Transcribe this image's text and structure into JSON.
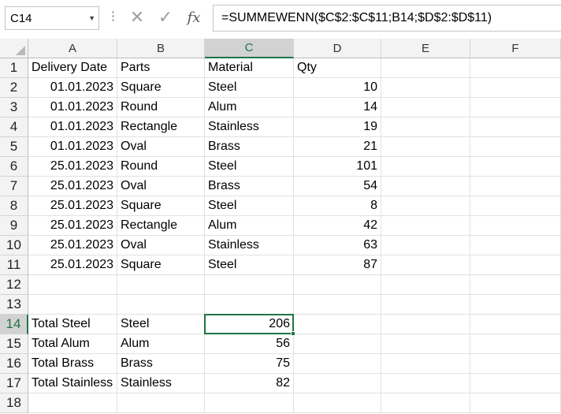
{
  "name_box": {
    "value": "C14"
  },
  "formula_bar": {
    "formula": "=SUMMEWENN($C$2:$C$11;B14;$D$2:$D$11)",
    "cancel_glyph": "✕",
    "enter_glyph": "✓",
    "fx_label": "fx"
  },
  "columns": [
    "A",
    "B",
    "C",
    "D",
    "E",
    "F"
  ],
  "active_column": "C",
  "active_row": 14,
  "rows": [
    {
      "n": "1",
      "a": "Delivery Date",
      "b": "Parts",
      "c": "Material",
      "d": "Qty"
    },
    {
      "n": "2",
      "a": "01.01.2023",
      "b": "Square",
      "c": "Steel",
      "d": "10"
    },
    {
      "n": "3",
      "a": "01.01.2023",
      "b": "Round",
      "c": "Alum",
      "d": "14"
    },
    {
      "n": "4",
      "a": "01.01.2023",
      "b": "Rectangle",
      "c": "Stainless",
      "d": "19"
    },
    {
      "n": "5",
      "a": "01.01.2023",
      "b": "Oval",
      "c": "Brass",
      "d": "21"
    },
    {
      "n": "6",
      "a": "25.01.2023",
      "b": "Round",
      "c": "Steel",
      "d": "101"
    },
    {
      "n": "7",
      "a": "25.01.2023",
      "b": "Oval",
      "c": "Brass",
      "d": "54"
    },
    {
      "n": "8",
      "a": "25.01.2023",
      "b": "Square",
      "c": "Steel",
      "d": "8"
    },
    {
      "n": "9",
      "a": "25.01.2023",
      "b": "Rectangle",
      "c": "Alum",
      "d": "42"
    },
    {
      "n": "10",
      "a": "25.01.2023",
      "b": "Oval",
      "c": "Stainless",
      "d": "63"
    },
    {
      "n": "11",
      "a": "25.01.2023",
      "b": "Square",
      "c": "Steel",
      "d": "87"
    },
    {
      "n": "12",
      "a": "",
      "b": "",
      "c": "",
      "d": ""
    },
    {
      "n": "13",
      "a": "",
      "b": "",
      "c": "",
      "d": ""
    },
    {
      "n": "14",
      "a": "Total Steel",
      "b": "Steel",
      "c": "206",
      "d": ""
    },
    {
      "n": "15",
      "a": "Total Alum",
      "b": "Alum",
      "c": "56",
      "d": ""
    },
    {
      "n": "16",
      "a": "Total Brass",
      "b": "Brass",
      "c": "75",
      "d": ""
    },
    {
      "n": "17",
      "a": "Total Stainless",
      "b": "Stainless",
      "c": "82",
      "d": ""
    },
    {
      "n": "18",
      "a": "",
      "b": "",
      "c": "",
      "d": ""
    }
  ],
  "colors": {
    "accent": "#217346",
    "header_bg": "#f3f3f3",
    "active_header_bg": "#d2d2d2",
    "gridline": "#e1e1e1"
  }
}
